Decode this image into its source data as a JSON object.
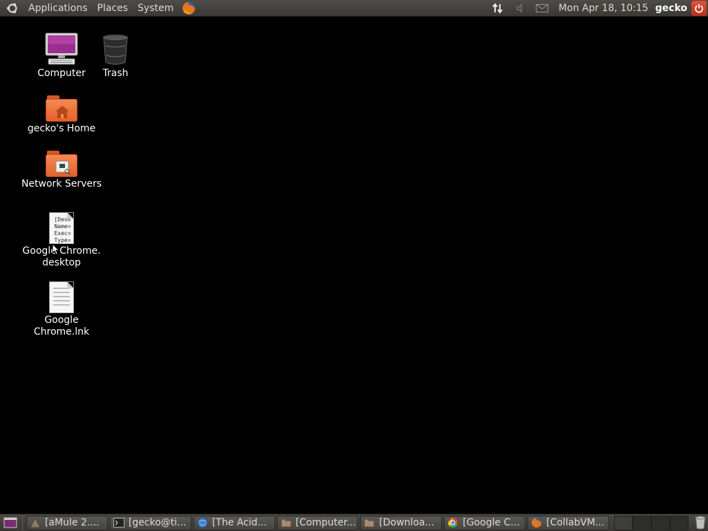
{
  "top_panel": {
    "menus": [
      "Applications",
      "Places",
      "System"
    ],
    "clock": "Mon Apr 18, 10:15",
    "username": "gecko"
  },
  "desktop": {
    "icons": [
      {
        "label": "Computer",
        "icon": "computer-icon"
      },
      {
        "label": "Trash",
        "icon": "trash-icon"
      },
      {
        "label": "gecko's Home",
        "icon": "home-folder-icon"
      },
      {
        "label": "Network Servers",
        "icon": "network-folder-icon"
      },
      {
        "label": "Google Chrome.\ndesktop",
        "icon": "desktop-file-icon",
        "preview_lines": [
          "[Desk",
          "Name=",
          "Exec=",
          "Type="
        ]
      },
      {
        "label": "Google Chrome.lnk",
        "icon": "text-file-icon"
      }
    ]
  },
  "taskbar": {
    "tasks": [
      {
        "label": "[aMule 2....",
        "icon": "amule-icon"
      },
      {
        "label": "[gecko@ti...",
        "icon": "terminal-icon"
      },
      {
        "label": "[The Acid...",
        "icon": "globe-icon"
      },
      {
        "label": "[Computer...",
        "icon": "file-manager-icon"
      },
      {
        "label": "[Downloa...",
        "icon": "file-manager-icon"
      },
      {
        "label": "[Google C...",
        "icon": "chrome-icon"
      },
      {
        "label": "[CollabVM...",
        "icon": "firefox-icon"
      }
    ],
    "workspace_count": 4
  },
  "colors": {
    "panel": "#3c3b37",
    "desktop_bg": "#000000",
    "folder_orange": "#f0743e",
    "power_red": "#c9412a"
  }
}
